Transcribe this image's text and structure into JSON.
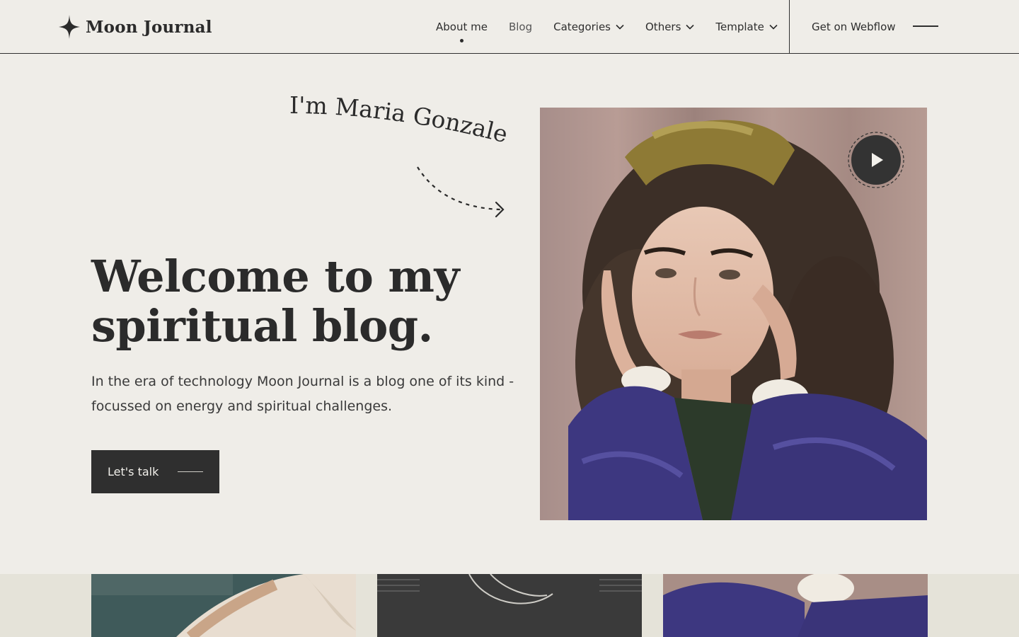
{
  "brand": {
    "name": "Moon Journal"
  },
  "nav": {
    "items": [
      {
        "label": "About me",
        "active": true,
        "dropdown": false
      },
      {
        "label": "Blog",
        "active": false,
        "dropdown": false
      },
      {
        "label": "Categories",
        "active": false,
        "dropdown": true
      },
      {
        "label": "Others",
        "active": false,
        "dropdown": true
      },
      {
        "label": "Template",
        "active": false,
        "dropdown": true
      }
    ],
    "cta": "Get on Webflow"
  },
  "hero": {
    "greeting": "I'm Maria Gonzalez",
    "title_line1": "Welcome to my",
    "title_line2": "spiritual blog.",
    "description": "In the era of technology Moon Journal is a blog one of its kind - focussed on energy and spiritual challenges.",
    "button": "Let's talk"
  },
  "icons": {
    "logo": "four-point-star-icon",
    "dropdown": "chevron-down-icon",
    "play": "play-icon",
    "menu": "menu-line-icon"
  },
  "colors": {
    "background": "#efede8",
    "text": "#2b2b2b",
    "button": "#2f2f2f",
    "strip": "#e5e3d9"
  }
}
